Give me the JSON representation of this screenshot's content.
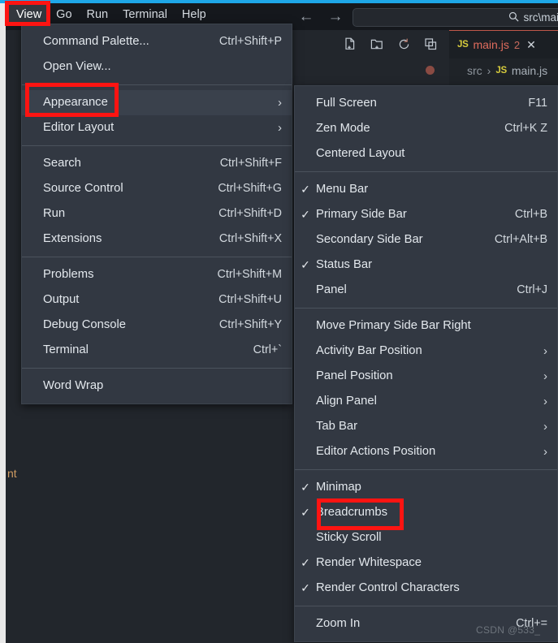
{
  "window": {
    "accent_color": "#1ea7e8",
    "menu_bg": "#323842",
    "highlight_color": "#fd1412"
  },
  "menubar": {
    "items": [
      {
        "label": "View",
        "active": true
      },
      {
        "label": "Go",
        "active": false
      },
      {
        "label": "Run",
        "active": false
      },
      {
        "label": "Terminal",
        "active": false
      },
      {
        "label": "Help",
        "active": false
      }
    ]
  },
  "command_center": {
    "icon": "search-icon",
    "value": "src\\main.js"
  },
  "navigation": {
    "back_icon": "←",
    "forward_icon": "→"
  },
  "view_menu": {
    "groups": [
      {
        "items": [
          {
            "label": "Command Palette...",
            "key": "Ctrl+Shift+P",
            "check": "",
            "arrow": "",
            "hover": false
          },
          {
            "label": "Open View...",
            "key": "",
            "check": "",
            "arrow": "",
            "hover": false
          }
        ]
      },
      {
        "items": [
          {
            "label": "Appearance",
            "key": "",
            "check": "",
            "arrow": "›",
            "hover": true
          },
          {
            "label": "Editor Layout",
            "key": "",
            "check": "",
            "arrow": "›",
            "hover": false
          }
        ]
      },
      {
        "items": [
          {
            "label": "Search",
            "key": "Ctrl+Shift+F",
            "check": "",
            "arrow": "",
            "hover": false
          },
          {
            "label": "Source Control",
            "key": "Ctrl+Shift+G",
            "check": "",
            "arrow": "",
            "hover": false
          },
          {
            "label": "Run",
            "key": "Ctrl+Shift+D",
            "check": "",
            "arrow": "",
            "hover": false
          },
          {
            "label": "Extensions",
            "key": "Ctrl+Shift+X",
            "check": "",
            "arrow": "",
            "hover": false
          }
        ]
      },
      {
        "items": [
          {
            "label": "Problems",
            "key": "Ctrl+Shift+M",
            "check": "",
            "arrow": "",
            "hover": false
          },
          {
            "label": "Output",
            "key": "Ctrl+Shift+U",
            "check": "",
            "arrow": "",
            "hover": false
          },
          {
            "label": "Debug Console",
            "key": "Ctrl+Shift+Y",
            "check": "",
            "arrow": "",
            "hover": false
          },
          {
            "label": "Terminal",
            "key": "Ctrl+`",
            "check": "",
            "arrow": "",
            "hover": false
          }
        ]
      },
      {
        "items": [
          {
            "label": "Word Wrap",
            "key": "",
            "check": "",
            "arrow": "",
            "hover": false
          }
        ]
      }
    ]
  },
  "appearance_menu": {
    "groups": [
      {
        "items": [
          {
            "label": "Full Screen",
            "key": "F11",
            "check": "",
            "arrow": "",
            "hover": false
          },
          {
            "label": "Zen Mode",
            "key": "Ctrl+K Z",
            "check": "",
            "arrow": "",
            "hover": false
          },
          {
            "label": "Centered Layout",
            "key": "",
            "check": "",
            "arrow": "",
            "hover": false
          }
        ]
      },
      {
        "items": [
          {
            "label": "Menu Bar",
            "key": "",
            "check": "✓",
            "arrow": "",
            "hover": false
          },
          {
            "label": "Primary Side Bar",
            "key": "Ctrl+B",
            "check": "✓",
            "arrow": "",
            "hover": false
          },
          {
            "label": "Secondary Side Bar",
            "key": "Ctrl+Alt+B",
            "check": "",
            "arrow": "",
            "hover": false
          },
          {
            "label": "Status Bar",
            "key": "",
            "check": "✓",
            "arrow": "",
            "hover": false
          },
          {
            "label": "Panel",
            "key": "Ctrl+J",
            "check": "",
            "arrow": "",
            "hover": false
          }
        ]
      },
      {
        "items": [
          {
            "label": "Move Primary Side Bar Right",
            "key": "",
            "check": "",
            "arrow": "",
            "hover": false
          },
          {
            "label": "Activity Bar Position",
            "key": "",
            "check": "",
            "arrow": "›",
            "hover": false
          },
          {
            "label": "Panel Position",
            "key": "",
            "check": "",
            "arrow": "›",
            "hover": false
          },
          {
            "label": "Align Panel",
            "key": "",
            "check": "",
            "arrow": "›",
            "hover": false
          },
          {
            "label": "Tab Bar",
            "key": "",
            "check": "",
            "arrow": "›",
            "hover": false
          },
          {
            "label": "Editor Actions Position",
            "key": "",
            "check": "",
            "arrow": "›",
            "hover": false
          }
        ]
      },
      {
        "items": [
          {
            "label": "Minimap",
            "key": "",
            "check": "✓",
            "arrow": "",
            "hover": false
          },
          {
            "label": "Breadcrumbs",
            "key": "",
            "check": "✓",
            "arrow": "",
            "hover": false
          },
          {
            "label": "Sticky Scroll",
            "key": "",
            "check": "",
            "arrow": "",
            "hover": false
          },
          {
            "label": "Render Whitespace",
            "key": "",
            "check": "✓",
            "arrow": "",
            "hover": false
          },
          {
            "label": "Render Control Characters",
            "key": "",
            "check": "✓",
            "arrow": "",
            "hover": false
          }
        ]
      },
      {
        "items": [
          {
            "label": "Zoom In",
            "key": "Ctrl+=",
            "check": "",
            "arrow": "",
            "hover": false
          }
        ]
      }
    ]
  },
  "explorer": {
    "actions": [
      {
        "icon": "new-file-icon"
      },
      {
        "icon": "new-folder-icon"
      },
      {
        "icon": "refresh-icon"
      },
      {
        "icon": "collapse-all-icon"
      }
    ],
    "tree_fragment": "nt"
  },
  "editor": {
    "tab": {
      "lang_badge": "JS",
      "filename": "main.js",
      "problem_count": "2",
      "close_icon": "✕"
    },
    "breadcrumb": {
      "folder": "src",
      "separator": "›",
      "lang_badge": "JS",
      "file": "main.js"
    }
  },
  "watermark": {
    "text": "CSDN @533_"
  }
}
